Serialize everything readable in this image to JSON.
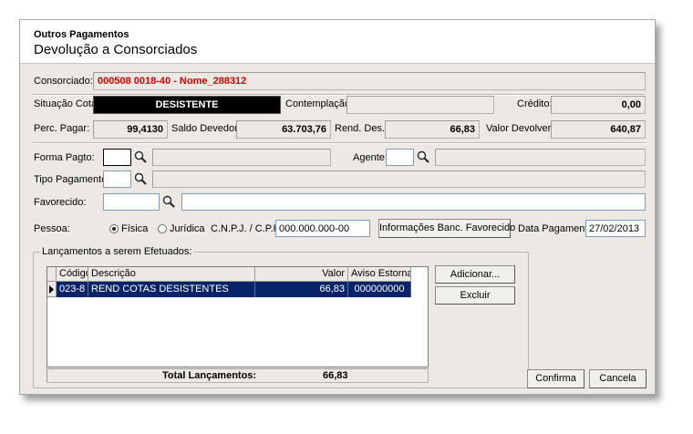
{
  "window": {
    "subtitle": "Outros Pagamentos",
    "title": "Devolução a Consorciados"
  },
  "consorciado": {
    "label": "Consorciado:",
    "value": "000508 0018-40 - Nome_288312",
    "value_color": "#e00000"
  },
  "situacao": {
    "label": "Situação Cota:",
    "value": "DESISTENTE"
  },
  "contemplacao": {
    "label": "Contemplação:",
    "value": ""
  },
  "credito": {
    "label": "Crédito:",
    "value": "0,00"
  },
  "perc_pagar": {
    "label": "Perc. Pagar:",
    "value": "99,4130"
  },
  "saldo_devedor": {
    "label": "Saldo Devedor:",
    "value": "63.703,76"
  },
  "rend_des": {
    "label": "Rend. Des.:",
    "value": "66,83"
  },
  "valor_devolver": {
    "label": "Valor Devolver:",
    "value": "640,87"
  },
  "forma_pagto": {
    "label": "Forma Pagto:",
    "value": "",
    "desc": ""
  },
  "agente": {
    "label": "Agente:",
    "value": "",
    "desc": ""
  },
  "tipo_pagamento": {
    "label": "Tipo Pagamento:",
    "value": "",
    "desc": ""
  },
  "favorecido": {
    "label": "Favorecido:",
    "value": "",
    "name": ""
  },
  "pessoa": {
    "label": "Pessoa:",
    "options": [
      "Física",
      "Jurídica"
    ],
    "selected": "Física"
  },
  "cnpj": {
    "label": "C.N.P.J. / C.P.F.:",
    "value": "000.000.000-00"
  },
  "info_banc_button": "Informações Banc. Favorecido",
  "data_pagamento": {
    "label": "Data Pagamento:",
    "value": "27/02/2013"
  },
  "lancamentos": {
    "group_title": "Lançamentos a serem Efetuados:",
    "columns": {
      "codigo": "Código",
      "descricao": "Descrição",
      "valor": "Valor",
      "aviso": "Aviso Estornar"
    },
    "rows": [
      {
        "codigo": "023-8",
        "descricao": "REND COTAS DESISTENTES",
        "valor": "66,83",
        "aviso": "000000000"
      }
    ],
    "total_label": "Total Lançamentos:",
    "total_value": "66,83"
  },
  "buttons": {
    "adicionar": "Adicionar...",
    "excluir": "Excluir",
    "confirma": "Confirma",
    "cancela": "Cancela"
  }
}
